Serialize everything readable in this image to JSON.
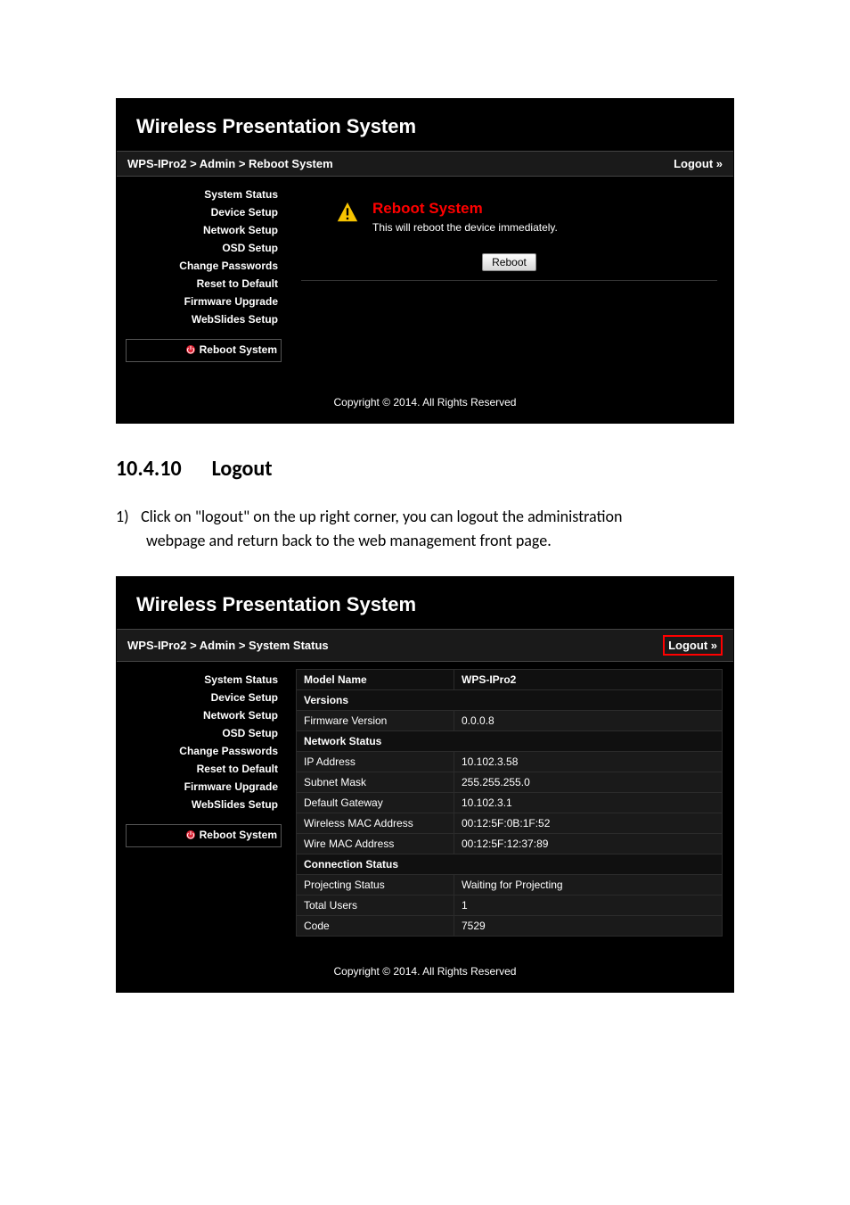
{
  "panel1": {
    "title": "Wireless Presentation System",
    "breadcrumb": "WPS-IPro2 > Admin > Reboot System",
    "logout": "Logout »",
    "nav": {
      "system_status": "System Status",
      "device_setup": "Device Setup",
      "network_setup": "Network Setup",
      "osd_setup": "OSD Setup",
      "change_passwords": "Change Passwords",
      "reset_to_default": "Reset to Default",
      "firmware_upgrade": "Firmware Upgrade",
      "webslides_setup": "WebSlides Setup",
      "reboot_system": "Reboot System"
    },
    "content": {
      "heading": "Reboot System",
      "sub": "This will reboot the device immediately.",
      "button": "Reboot"
    },
    "footer": "Copyright © 2014. All Rights Reserved"
  },
  "section": {
    "number": "10.4.10",
    "title": "Logout",
    "step_num": "1)",
    "step_line1": "Click on \"logout\" on the up right corner, you can logout the administration",
    "step_line2": "webpage and return back to the web management front page."
  },
  "panel2": {
    "title": "Wireless Presentation System",
    "breadcrumb": "WPS-IPro2 > Admin > System Status",
    "logout": "Logout »",
    "nav": {
      "system_status": "System Status",
      "device_setup": "Device Setup",
      "network_setup": "Network Setup",
      "osd_setup": "OSD Setup",
      "change_passwords": "Change Passwords",
      "reset_to_default": "Reset to Default",
      "firmware_upgrade": "Firmware Upgrade",
      "webslides_setup": "WebSlides Setup",
      "reboot_system": "Reboot System"
    },
    "table": {
      "model_name_label": "Model Name",
      "model_name_value": "WPS-IPro2",
      "versions_header": "Versions",
      "firmware_version_label": "Firmware Version",
      "firmware_version_value": "0.0.0.8",
      "network_status_header": "Network Status",
      "ip_address_label": "IP Address",
      "ip_address_value": "10.102.3.58",
      "subnet_mask_label": "Subnet Mask",
      "subnet_mask_value": "255.255.255.0",
      "default_gateway_label": "Default Gateway",
      "default_gateway_value": "10.102.3.1",
      "wireless_mac_label": "Wireless MAC Address",
      "wireless_mac_value": "00:12:5F:0B:1F:52",
      "wire_mac_label": "Wire MAC Address",
      "wire_mac_value": "00:12:5F:12:37:89",
      "connection_status_header": "Connection Status",
      "projecting_status_label": "Projecting Status",
      "projecting_status_value": "Waiting for Projecting",
      "total_users_label": "Total Users",
      "total_users_value": "1",
      "code_label": "Code",
      "code_value": "7529"
    },
    "footer": "Copyright © 2014. All Rights Reserved"
  }
}
